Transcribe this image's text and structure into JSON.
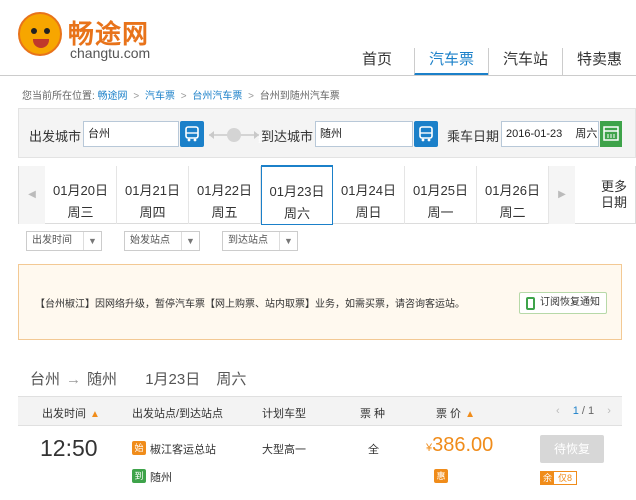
{
  "brand": {
    "name_cn": "畅途网",
    "name_en": "changtu.com"
  },
  "nav": [
    {
      "label": "首页"
    },
    {
      "label": "汽车票"
    },
    {
      "label": "汽车站"
    },
    {
      "label": "特卖惠"
    }
  ],
  "breadcrumb": {
    "prefix": "您当前所在位置:",
    "items": [
      "畅途网",
      "汽车票",
      "台州汽车票",
      "台州到随州汽车票"
    ],
    "separator": ">"
  },
  "search": {
    "from_label": "出发城市",
    "from_value": "台州",
    "swap_label": "换",
    "to_label": "到达城市",
    "to_value": "随州",
    "date_label": "乘车日期",
    "date_value": "2016-01-23",
    "weekday": "周六"
  },
  "dates": [
    {
      "date": "01月20日",
      "weekday": "周三"
    },
    {
      "date": "01月21日",
      "weekday": "周四"
    },
    {
      "date": "01月22日",
      "weekday": "周五"
    },
    {
      "date": "01月23日",
      "weekday": "周六"
    },
    {
      "date": "01月24日",
      "weekday": "周日"
    },
    {
      "date": "01月25日",
      "weekday": "周一"
    },
    {
      "date": "01月26日",
      "weekday": "周二"
    }
  ],
  "more_dates": {
    "line1": "更多",
    "line2": "日期"
  },
  "filters": [
    {
      "label": "出发时间"
    },
    {
      "label": "始发站点"
    },
    {
      "label": "到达站点"
    }
  ],
  "notice": {
    "text": "【台州椒江】因网络升级，暂停汽车票【网上购票、站内取票】业务，如需买票，请咨询客运站。",
    "button": "订阅恢复通知"
  },
  "route": {
    "from": "台州",
    "arrow": "→",
    "to": "随州",
    "date": "1月23日",
    "weekday": "周六"
  },
  "table": {
    "headers": {
      "time": "出发时间",
      "stations": "出发站点/到达站点",
      "bus_type": "计划车型",
      "ticket_type": "票 种",
      "price": "票 价"
    },
    "pager": {
      "prev": "‹",
      "current": "1",
      "sep": "/",
      "total": "1",
      "next": "›"
    },
    "rows": [
      {
        "time": "12:50",
        "depart_badge": "始",
        "depart_station": "椒江客运总站",
        "arrive_badge": "到",
        "arrive_station": "随州",
        "bus_type": "大型高一",
        "ticket_type": "全",
        "price_currency": "¥",
        "price": "386.00",
        "discount_badge": "惠",
        "action": "待恢复",
        "remain_label": "余",
        "remain_value": "仅8"
      }
    ]
  },
  "colors": {
    "primary": "#1b80c9",
    "accent": "#f08c1a",
    "green": "#3ea34a",
    "brand_orange": "#e8731a"
  }
}
